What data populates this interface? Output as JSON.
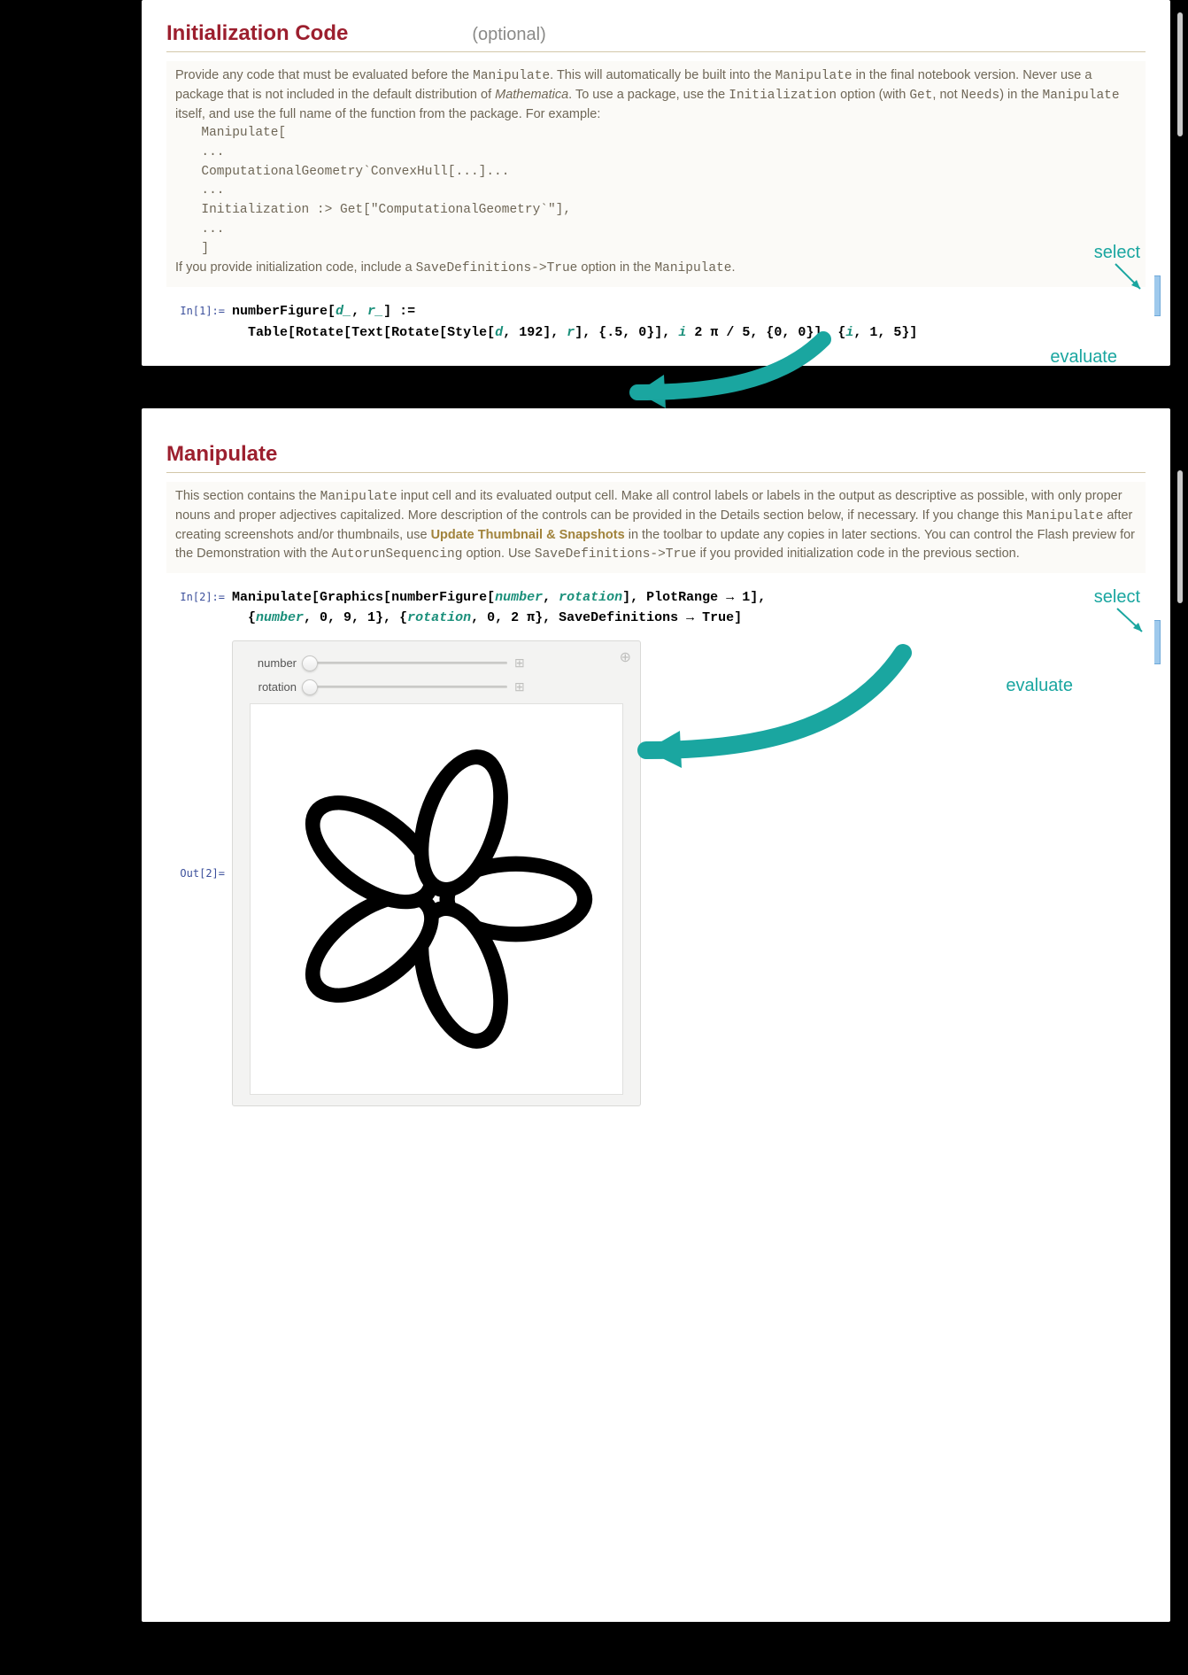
{
  "section1": {
    "title": "Initialization Code",
    "optional": "(optional)",
    "desc": {
      "l1a": "Provide any code that must be evaluated before the ",
      "l1b": "Manipulate",
      "l1c": ". This will automatically be built into the ",
      "l2a": "Manipulate",
      "l2b": " in the final notebook version. Never use a package that is not included in the default distribution of ",
      "l2c": "Mathematica",
      "l2d": ". To use a package, use the ",
      "l2e": "Initialization",
      "l2f": " option (with ",
      "l2g": "Get",
      "l2h": ", not ",
      "l2i": "Needs",
      "l2j": ") in the ",
      "l3a": "Manipulate",
      "l3b": " itself, and use the full name of the function from the package. For example:",
      "code": "  Manipulate[\n  ...\n  ComputationalGeometry`ConvexHull[...]...\n  ...\n  Initialization :> Get[\"ComputationalGeometry`\"],\n  ...\n  ]",
      "l4a": "If you provide initialization code, include a ",
      "l4b": "SaveDefinitions->True",
      "l4c": " option in the ",
      "l4d": "Manipulate",
      "l4e": "."
    },
    "in_label": "In[1]:=",
    "code": {
      "p1": "numberFigure",
      "p2": "[",
      "p3": "d_",
      "p4": ", ",
      "p5": "r_",
      "p6": "] :=",
      "p7": "Table",
      "p8": "[",
      "p9": "Rotate",
      "p10": "[",
      "p11": "Text",
      "p12": "[",
      "p13": "Rotate",
      "p14": "[",
      "p15": "Style",
      "p16": "[",
      "p17": "d",
      "p18": ", 192",
      "p19": "]",
      "p20": ", ",
      "p21": "r",
      "p22": "]",
      "p23": ", {.5, 0}",
      "p24": "]",
      "p25": ", ",
      "p26": "i",
      "p27": " 2 π / 5, {0, 0}",
      "p28": "]",
      "p29": ", {",
      "p30": "i",
      "p31": ", 1, 5}",
      "p32": "]"
    },
    "annot_select": "select",
    "annot_evaluate": "evaluate"
  },
  "section2": {
    "title": "Manipulate",
    "desc": {
      "t1a": "This section contains the ",
      "t1b": "Manipulate",
      "t1c": " input cell and its evaluated output cell. Make all control labels or labels in the output as descriptive as possible, with only proper nouns and proper adjectives capitalized. More description of the controls can be provided in the Details section below, if necessary. If you change this ",
      "t1d": "Manipulate",
      "t1e": " after creating screenshots and/or thumbnails, use ",
      "t1f": "Update Thumbnail & Snapshots",
      "t1g": " in the toolbar to update any copies in later sections. You can control the Flash preview for the Demonstration with the ",
      "t1h": "AutorunSequencing",
      "t1i": " option. Use ",
      "t1j": "SaveDefinitions->True",
      "t1k": " if you provided initialization code in the previous section."
    },
    "in_label": "In[2]:=",
    "out_label": "Out[2]=",
    "code": {
      "q1": "Manipulate",
      "q2": "[",
      "q3": "Graphics",
      "q4": "[",
      "q5": "numberFigure",
      "q6": "[",
      "q7": "number",
      "q8": ", ",
      "q9": "rotation",
      "q10": "]",
      "q11": ", PlotRange → 1",
      "q12": "]",
      "q13": ",",
      "q14": "{",
      "q15": "number",
      "q16": ", 0, 9, 1}, {",
      "q17": "rotation",
      "q18": ", 0, 2 π}, SaveDefinitions → True",
      "q19": "]"
    },
    "sliders": {
      "s1": "number",
      "s2": "rotation"
    },
    "annot_select": "select",
    "annot_evaluate": "evaluate"
  }
}
